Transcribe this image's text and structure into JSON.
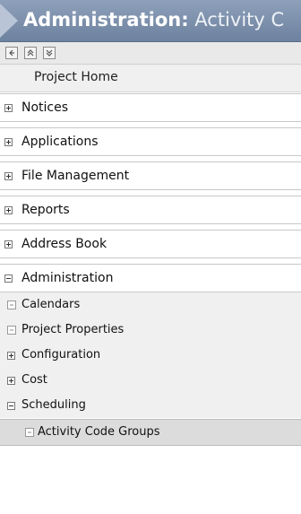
{
  "header": {
    "title_prefix": "Administration:",
    "title_rest": "Activity C"
  },
  "toolbar": {
    "buttons": [
      "back-icon",
      "collapse-all-icon",
      "expand-all-icon"
    ]
  },
  "nav": {
    "project_home": "Project Home",
    "items": [
      {
        "label": "Notices",
        "state": "collapsed"
      },
      {
        "label": "Applications",
        "state": "collapsed"
      },
      {
        "label": "File Management",
        "state": "collapsed"
      },
      {
        "label": "Reports",
        "state": "collapsed"
      },
      {
        "label": "Address Book",
        "state": "collapsed"
      },
      {
        "label": "Administration",
        "state": "expanded"
      }
    ],
    "admin_children": [
      {
        "label": "Calendars",
        "kind": "leaf"
      },
      {
        "label": "Project Properties",
        "kind": "leaf"
      },
      {
        "label": "Configuration",
        "kind": "collapsed"
      },
      {
        "label": "Cost",
        "kind": "collapsed"
      },
      {
        "label": "Scheduling",
        "kind": "expanded"
      }
    ],
    "selected": {
      "label": "Activity Code Groups"
    }
  },
  "colors": {
    "header": "#7b8fab",
    "selected_bg": "#dcdcdc",
    "sub_bg": "#f0f0f0"
  }
}
